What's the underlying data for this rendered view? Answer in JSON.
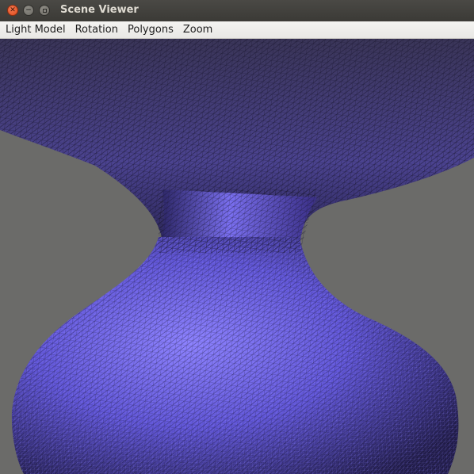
{
  "window": {
    "title": "Scene Viewer",
    "close_icon": "close-icon",
    "minimize_icon": "minimize-icon",
    "maximize_icon": "maximize-icon"
  },
  "menubar": {
    "items": [
      {
        "label": "Light Model"
      },
      {
        "label": "Rotation"
      },
      {
        "label": "Polygons"
      },
      {
        "label": "Zoom"
      }
    ]
  },
  "viewport": {
    "background_color": "#6b6b69",
    "mesh_color": "#5b4fd1",
    "render_mode": "wireframe"
  }
}
